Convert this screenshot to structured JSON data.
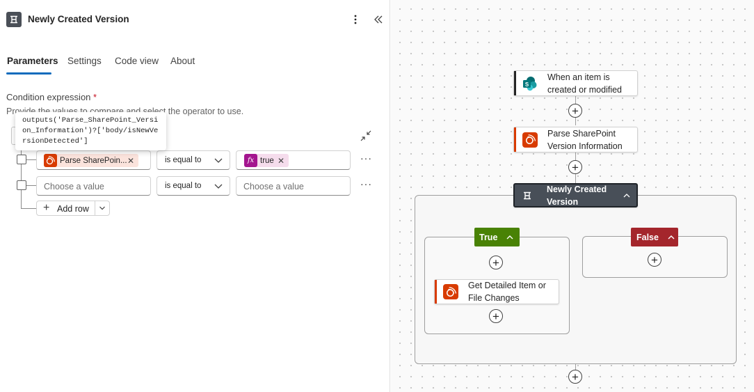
{
  "header": {
    "title": "Newly Created Version"
  },
  "tabs": [
    {
      "label": "Parameters",
      "active": true
    },
    {
      "label": "Settings",
      "active": false
    },
    {
      "label": "Code view",
      "active": false
    },
    {
      "label": "About",
      "active": false
    }
  ],
  "condition": {
    "label": "Condition expression",
    "required_mark": "*",
    "hint": "Provide the values to compare and select the operator to use.",
    "tooltip": "outputs('Parse_SharePoint_Version_Information')?['body/isNewVersionDetected']",
    "rows": [
      {
        "left_token": "Parse SharePoin...",
        "operator": "is equal to",
        "right_token": "true",
        "right_token_icon": "fx"
      },
      {
        "left_placeholder": "Choose a value",
        "operator": "is equal to",
        "right_placeholder": "Choose a value"
      }
    ],
    "add_row_label": "Add row"
  },
  "flow": {
    "trigger": {
      "label": "When an item is created or modified"
    },
    "parse": {
      "label": "Parse SharePoint Version Information"
    },
    "condition": {
      "label": "Newly Created Version"
    },
    "true_branch": {
      "label": "True"
    },
    "false_branch": {
      "label": "False"
    },
    "details": {
      "label": "Get Detailed Item or File Changes"
    }
  },
  "colors": {
    "accent_blue": "#0f6cbd",
    "sharepoint_teal": "#036c70",
    "action_orange": "#d83b01",
    "condition_dark": "#484f58",
    "true_green": "#498205",
    "false_red": "#a4262c",
    "fx_purple": "#a4168f"
  }
}
